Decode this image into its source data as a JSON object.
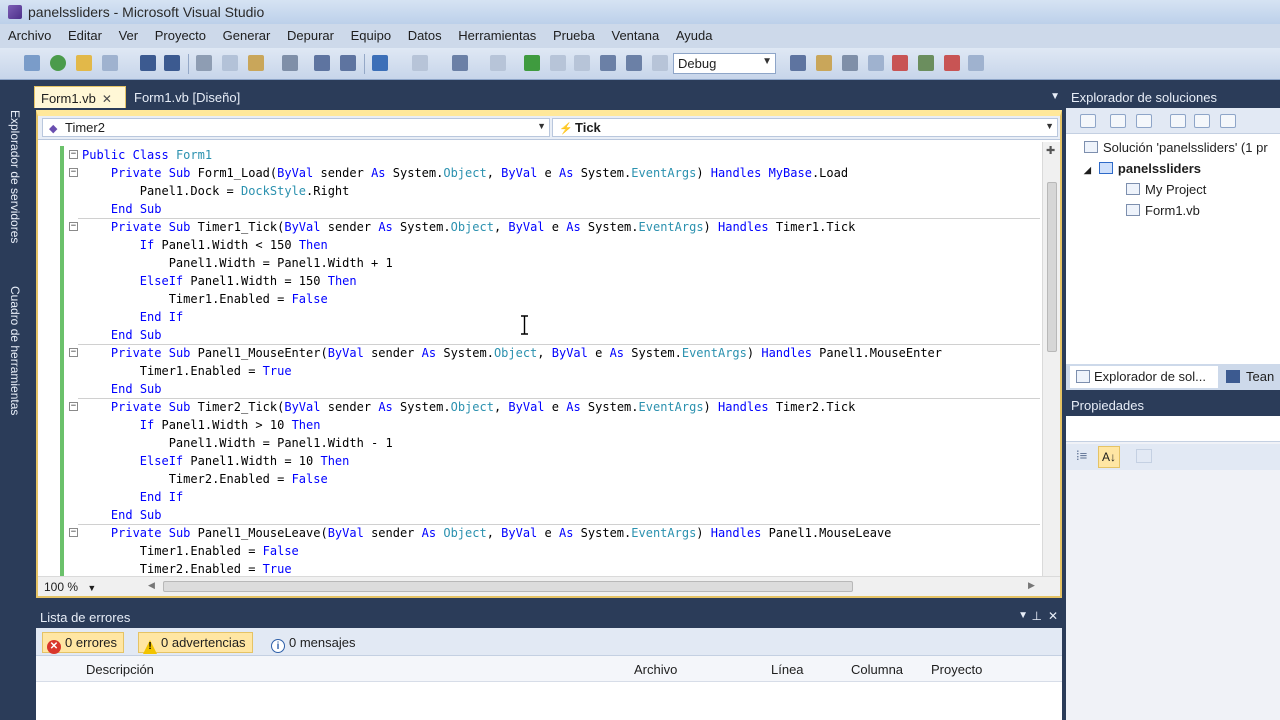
{
  "window": {
    "title": "panelssliders - Microsoft Visual Studio"
  },
  "menu": [
    "Archivo",
    "Editar",
    "Ver",
    "Proyecto",
    "Generar",
    "Depurar",
    "Equipo",
    "Datos",
    "Herramientas",
    "Prueba",
    "Ventana",
    "Ayuda"
  ],
  "toolbar": {
    "config": "Debug"
  },
  "leftstrip": {
    "server_explorer": "Explorador de servidores",
    "toolbox": "Cuadro de herramientas"
  },
  "tabs": [
    {
      "label": "Form1.vb",
      "close": "✕"
    },
    {
      "label": "Form1.vb [Diseño]"
    }
  ],
  "editor": {
    "class_combo": "Timer2",
    "method_combo": "Tick",
    "zoom": "100 %",
    "lines": [
      "Public Class Form1",
      "    Private Sub Form1_Load(ByVal sender As System.Object, ByVal e As System.EventArgs) Handles MyBase.Load",
      "        Panel1.Dock = DockStyle.Right",
      "    End Sub",
      "    Private Sub Timer1_Tick(ByVal sender As System.Object, ByVal e As System.EventArgs) Handles Timer1.Tick",
      "        If Panel1.Width < 150 Then",
      "            Panel1.Width = Panel1.Width + 1",
      "        ElseIf Panel1.Width = 150 Then",
      "            Timer1.Enabled = False",
      "        End If",
      "    End Sub",
      "    Private Sub Panel1_MouseEnter(ByVal sender As System.Object, ByVal e As System.EventArgs) Handles Panel1.MouseEnter",
      "        Timer1.Enabled = True",
      "    End Sub",
      "    Private Sub Timer2_Tick(ByVal sender As System.Object, ByVal e As System.EventArgs) Handles Timer2.Tick",
      "        If Panel1.Width > 10 Then",
      "            Panel1.Width = Panel1.Width - 1",
      "        ElseIf Panel1.Width = 10 Then",
      "            Timer2.Enabled = False",
      "        End If",
      "    End Sub",
      "    Private Sub Panel1_MouseLeave(ByVal sender As Object, ByVal e As System.EventArgs) Handles Panel1.MouseLeave",
      "        Timer1.Enabled = False",
      "        Timer2.Enabled = True"
    ],
    "fold_lines": [
      0,
      1,
      4,
      11,
      14,
      21
    ],
    "separator_after": [
      3,
      10,
      13,
      20
    ],
    "keywords": [
      "Public",
      "Class",
      "Private",
      "Sub",
      "ByVal",
      "As",
      "Handles",
      "End",
      "If",
      "Then",
      "ElseIf",
      "False",
      "True",
      "MyBase"
    ],
    "types": [
      "Form1",
      "Object",
      "EventArgs",
      "DockStyle"
    ]
  },
  "solution_explorer": {
    "title": "Explorador de soluciones",
    "solution": "Solución 'panelssliders' (1 pr",
    "project": "panelssliders",
    "items": [
      "My Project",
      "Form1.vb"
    ],
    "tab_active": "Explorador de sol...",
    "tab_other": "Tean"
  },
  "properties": {
    "title": "Propiedades"
  },
  "error_list": {
    "title": "Lista de errores",
    "errors": "0 errores",
    "warnings": "0 advertencias",
    "messages": "0 mensajes",
    "columns": [
      "Descripción",
      "Archivo",
      "Línea",
      "Columna",
      "Proyecto"
    ]
  },
  "colors": {
    "keyword": "#0000ff",
    "type": "#2b91af",
    "accent": "#e5c365",
    "chrome": "#2b3c59"
  }
}
